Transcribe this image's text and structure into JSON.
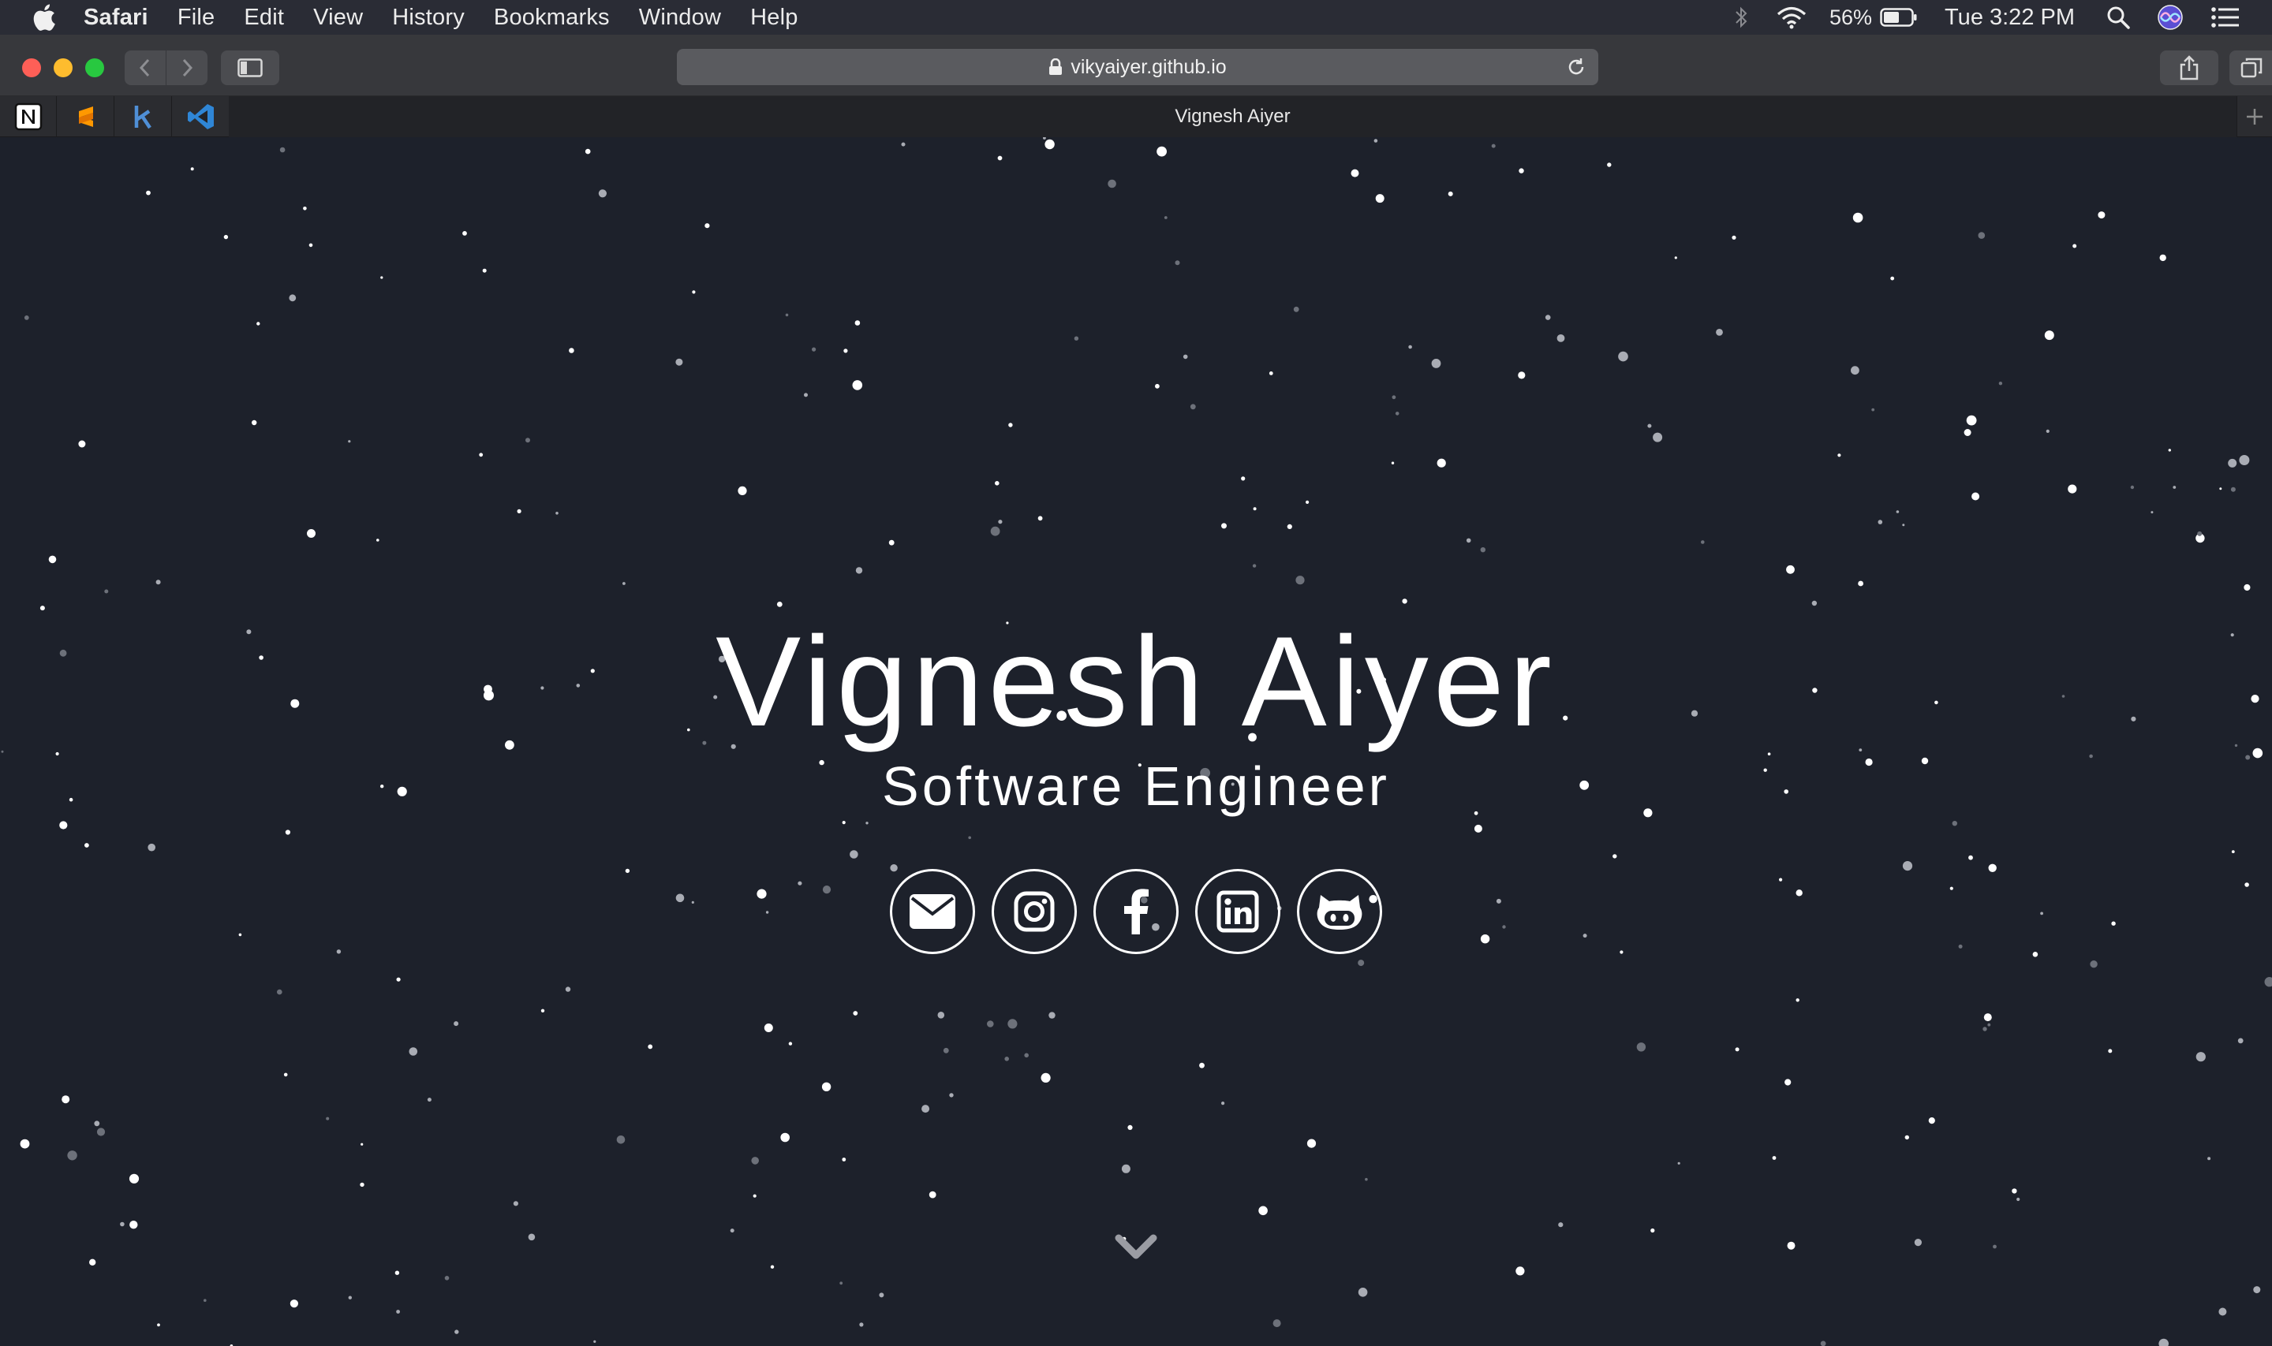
{
  "menubar": {
    "apple_icon": "apple-logo-icon",
    "items": [
      "Safari",
      "File",
      "Edit",
      "View",
      "History",
      "Bookmarks",
      "Window",
      "Help"
    ],
    "battery_percent": "56%",
    "clock": "Tue 3:22 PM",
    "status_icons": [
      "bluetooth-icon",
      "wifi-icon",
      "battery-icon",
      "spotlight-search-icon",
      "siri-icon",
      "notification-center-icon"
    ]
  },
  "browser": {
    "url": "vikyaiyer.github.io",
    "active_tab_title": "Vignesh Aiyer",
    "pinned_tabs": [
      "notion-icon",
      "sublime-icon",
      "k-icon",
      "vscode-icon"
    ],
    "colors": {
      "close": "#fe5f57",
      "minimize": "#febc2e",
      "zoom": "#28c840"
    }
  },
  "hero": {
    "name": "Vignesh Aiyer",
    "title": "Software Engineer",
    "background_color": "#1d212b",
    "socials": [
      "envelope-icon",
      "instagram-icon",
      "facebook-icon",
      "linkedin-icon",
      "github-icon"
    ],
    "scroll_icon": "chevron-down-icon"
  }
}
